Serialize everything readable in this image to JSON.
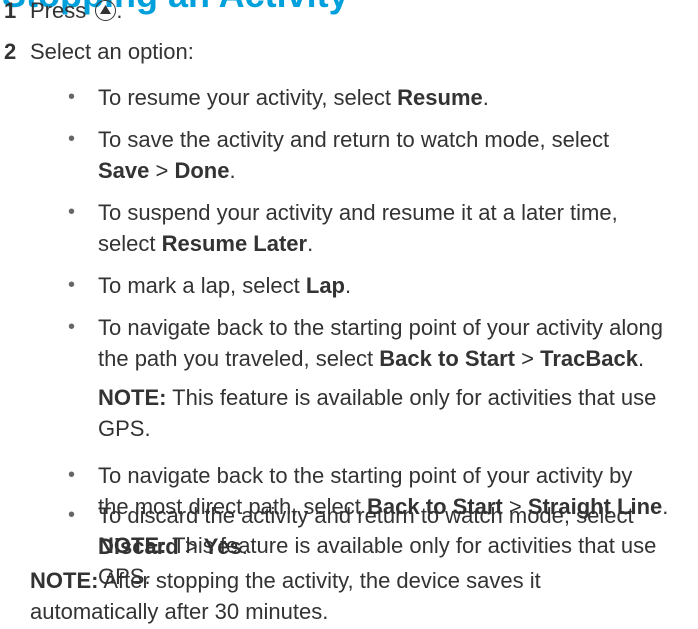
{
  "heading": "Stopping an Activity",
  "steps": [
    {
      "num": "1",
      "text": "Press ",
      "icon": "up-button-icon",
      "after": "."
    },
    {
      "num": "2",
      "text": "Select an option:"
    }
  ],
  "bullets": [
    {
      "lines": [
        [
          "To resume your activity, select ",
          "Resume",
          "."
        ]
      ]
    },
    {
      "lines": [
        [
          "To save the activity and return to watch mode, select"
        ],
        [
          "",
          "Save",
          " > ",
          "Done",
          "."
        ]
      ]
    },
    {
      "lines": [
        [
          "To suspend your activity and resume it at a later time,"
        ],
        [
          "select ",
          "Resume Later",
          "."
        ]
      ]
    },
    {
      "lines": [
        [
          "To mark a lap, select ",
          "Lap",
          "."
        ]
      ]
    },
    {
      "lines": [
        [
          "To navigate back to the starting point of your activity along"
        ],
        [
          "the path you traveled, select ",
          "Back to Start",
          " > ",
          "TracBack",
          "."
        ]
      ],
      "note": {
        "label": "NOTE:",
        "lines": [
          " This feature is available only for activities that use",
          "GPS."
        ]
      }
    },
    {
      "lines": [
        [
          "To navigate back to the starting point of your activity by"
        ],
        [
          "the most direct path, select ",
          "Back to Start",
          " > ",
          "Straight Line",
          "."
        ]
      ],
      "note": {
        "label": "NOTE:",
        "lines": [
          " This feature is available only for activities that use",
          "GPS."
        ]
      }
    },
    {
      "lines": [
        [
          "To discard the activity and return to watch mode, select"
        ],
        [
          "",
          "Discard",
          " > ",
          "Yes",
          "."
        ]
      ]
    }
  ],
  "final_note": {
    "label": "NOTE:",
    "lines": [
      " After stopping the activity, the device saves it",
      "automatically after 30 minutes."
    ]
  },
  "bullet_char": "•"
}
